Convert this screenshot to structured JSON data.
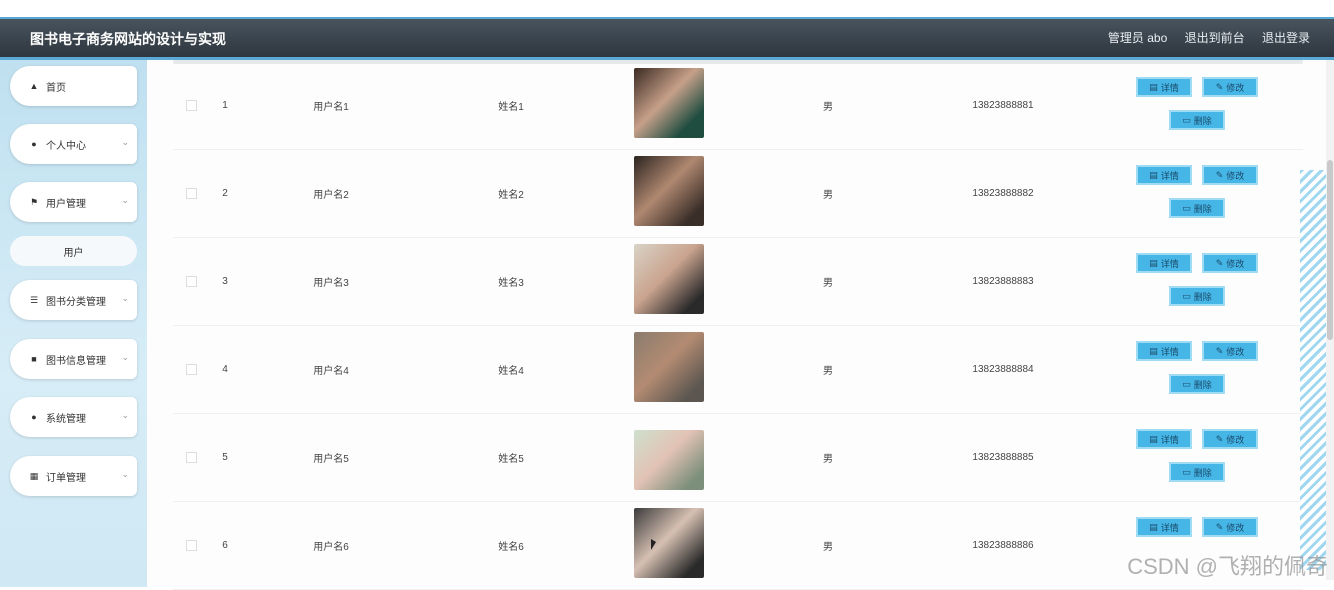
{
  "header": {
    "title": "图书电子商务网站的设计与实现",
    "admin_label": "管理员 abo",
    "back_label": "退出到前台",
    "logout_label": "退出登录"
  },
  "sidebar": {
    "items": [
      {
        "label": "首页",
        "icon": "home-icon"
      },
      {
        "label": "个人中心",
        "icon": "user-icon"
      },
      {
        "label": "用户管理",
        "icon": "flag-icon"
      },
      {
        "label": "图书分类管理",
        "icon": "list-icon"
      },
      {
        "label": "图书信息管理",
        "icon": "message-icon"
      },
      {
        "label": "系统管理",
        "icon": "user-icon"
      },
      {
        "label": "订单管理",
        "icon": "grid-icon"
      }
    ],
    "sub_item": "用户"
  },
  "table": {
    "rows": [
      {
        "index": "1",
        "username": "用户名1",
        "name": "姓名1",
        "gender": "男",
        "phone": "13823888881"
      },
      {
        "index": "2",
        "username": "用户名2",
        "name": "姓名2",
        "gender": "男",
        "phone": "13823888882"
      },
      {
        "index": "3",
        "username": "用户名3",
        "name": "姓名3",
        "gender": "男",
        "phone": "13823888883"
      },
      {
        "index": "4",
        "username": "用户名4",
        "name": "姓名4",
        "gender": "男",
        "phone": "13823888884"
      },
      {
        "index": "5",
        "username": "用户名5",
        "name": "姓名5",
        "gender": "男",
        "phone": "13823888885"
      },
      {
        "index": "6",
        "username": "用户名6",
        "name": "姓名6",
        "gender": "男",
        "phone": "13823888886"
      }
    ],
    "detail_label": "详情",
    "edit_label": "修改",
    "delete_label": "删除"
  },
  "watermark": "CSDN @飞翔的佩奇",
  "colors": {
    "accent": "#45b6e6",
    "header": "#2c343c"
  }
}
